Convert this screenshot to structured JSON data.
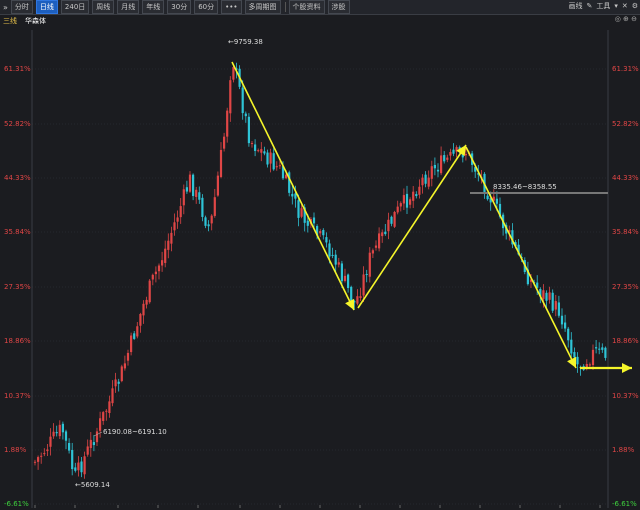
{
  "toolbar": {
    "collapse_icon": "double-chevron-right-icon",
    "periods": [
      {
        "label": "分时",
        "active": false
      },
      {
        "label": "日线",
        "active": true
      },
      {
        "label": "240日",
        "active": false
      },
      {
        "label": "周线",
        "active": false
      },
      {
        "label": "月线",
        "active": false
      },
      {
        "label": "年线",
        "active": false
      },
      {
        "label": "30分",
        "active": false
      },
      {
        "label": "60分",
        "active": false
      }
    ],
    "more_label": "•••",
    "multi_period_label": "多周期图",
    "stock_info_label": "个股资料",
    "related_label": "涉股",
    "right_label": "画线",
    "tools_label": "工具",
    "icons": {
      "pen": "pen-icon",
      "tools_dropdown": "chevron-down-icon",
      "close": "close-icon",
      "settings": "gear-icon"
    }
  },
  "subbar": {
    "indicator": "三线",
    "name": "华森体",
    "right_icons": "◎ ⊕ ⊖"
  },
  "colors": {
    "up": "#e04646",
    "down": "#2ec4d6",
    "axis_red": "#e04646",
    "axis_green": "#3ecf3e",
    "arrow": "#f5f52a",
    "bg": "#1b1c20",
    "grid": "#33363d"
  },
  "chart_data": {
    "type": "candlestick",
    "y_ticks_left": [
      "61.31%",
      "52.82%",
      "44.33%",
      "35.84%",
      "27.35%",
      "18.86%",
      "10.37%",
      "1.88%",
      "-6.61%"
    ],
    "y_ticks_right": [
      "61.31%",
      "52.82%",
      "44.33%",
      "35.84%",
      "27.35%",
      "18.86%",
      "10.37%",
      "1.88%",
      "-6.61%"
    ],
    "high_label": "9759.38",
    "low_label": "5609.14",
    "level_label_low": "6190.08~6191.10",
    "level_label_mid": "8335.46~8358.55",
    "trend_arrows": "zigzag: up to peak, down, up, down, flat"
  }
}
